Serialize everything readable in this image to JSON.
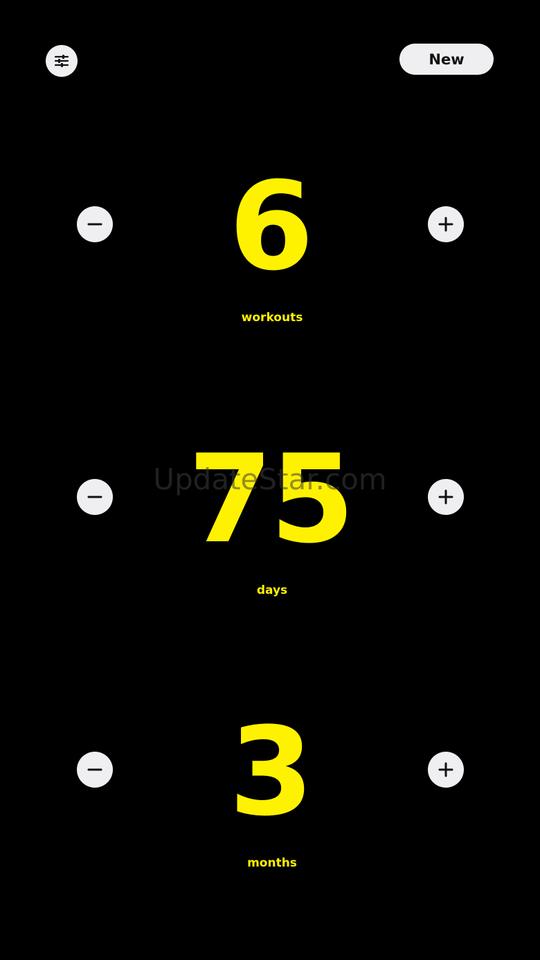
{
  "header": {
    "settings_icon": "sliders-icon",
    "new_label": "New"
  },
  "colors": {
    "background": "#000000",
    "accent": "#fff200",
    "button_bg": "#efeff1",
    "button_fg": "#111111"
  },
  "counters": [
    {
      "value": "6",
      "unit": "workouts"
    },
    {
      "value": "75",
      "unit": "days"
    },
    {
      "value": "3",
      "unit": "months"
    }
  ],
  "watermark": "UpdateStar.com"
}
